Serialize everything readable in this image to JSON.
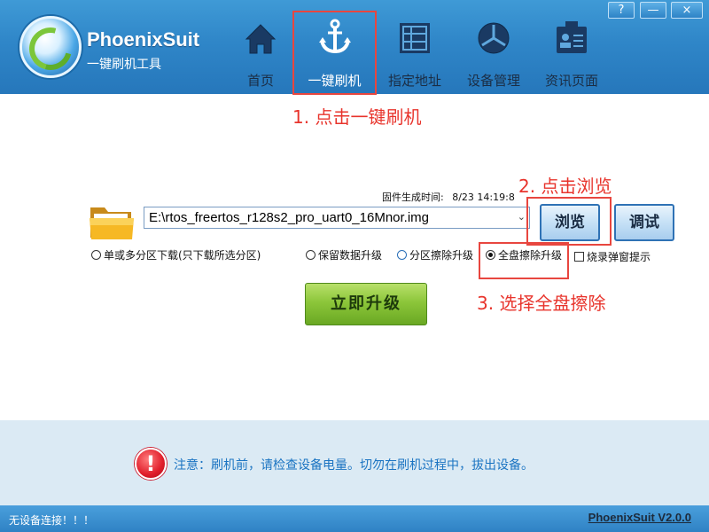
{
  "window": {
    "help_label": "?",
    "minimize_label": "—",
    "close_label": "×"
  },
  "header": {
    "app_title": "PhoenixSuit",
    "app_subtitle": "一键刷机工具",
    "nav": [
      {
        "label": "首页",
        "icon": "home-icon"
      },
      {
        "label": "一键刷机",
        "icon": "anchor-icon"
      },
      {
        "label": "指定地址",
        "icon": "grid-icon"
      },
      {
        "label": "设备管理",
        "icon": "device-icon"
      },
      {
        "label": "资讯页面",
        "icon": "id-card-icon"
      }
    ]
  },
  "annotations": {
    "step1": "1. 点击一键刷机",
    "step2": "2. 点击浏览",
    "step3": "3. 选择全盘擦除"
  },
  "main": {
    "firmware_time_label": "固件生成时间:",
    "firmware_time_value": "8/23 14:19:8",
    "firmware_path": "E:\\rtos_freertos_r128s2_pro_uart0_16Mnor.img",
    "browse_label": "浏览",
    "debug_label": "调试",
    "options": {
      "partition_download": "单或多分区下载(只下载所选分区)",
      "keep_data": "保留数据升级",
      "partition_erase": "分区擦除升级",
      "full_erase": "全盘擦除升级",
      "popup_hint": "烧录弹窗提示"
    },
    "selected_option": "full_erase",
    "upgrade_label": "立即升级"
  },
  "notice": {
    "icon_label": "!",
    "text": "注意：刷机前，请检查设备电量。切勿在刷机过程中，拔出设备。"
  },
  "status": {
    "connection": "无设备连接！！！",
    "version": "PhoenixSuit V2.0.0"
  },
  "colors": {
    "header_blue": "#2f86c8",
    "annotation_red": "#e8342c",
    "upgrade_green": "#8cc63a",
    "notice_bg": "#dbeaf4",
    "notice_text": "#1b74c2"
  }
}
